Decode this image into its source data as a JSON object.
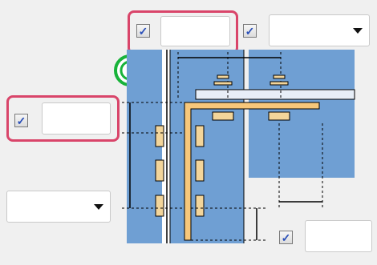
{
  "controls": {
    "top_checkbox_1": {
      "checked": true,
      "value": ""
    },
    "top_checkbox_2": {
      "checked": true
    },
    "top_dropdown": {
      "selected": ""
    },
    "left_checkbox": {
      "checked": true,
      "value": ""
    },
    "left_dropdown": {
      "selected": ""
    },
    "bottom_checkbox": {
      "checked": true,
      "value": ""
    }
  },
  "icons": {
    "checkmark": "✓",
    "dropdown": "chevron-down-icon",
    "target": "target-icon"
  },
  "colors": {
    "highlight_frame": "#d9456a",
    "panel_blue": "#6f9fd3",
    "beam": "#f7c77a",
    "target_green": "#18b33a"
  }
}
